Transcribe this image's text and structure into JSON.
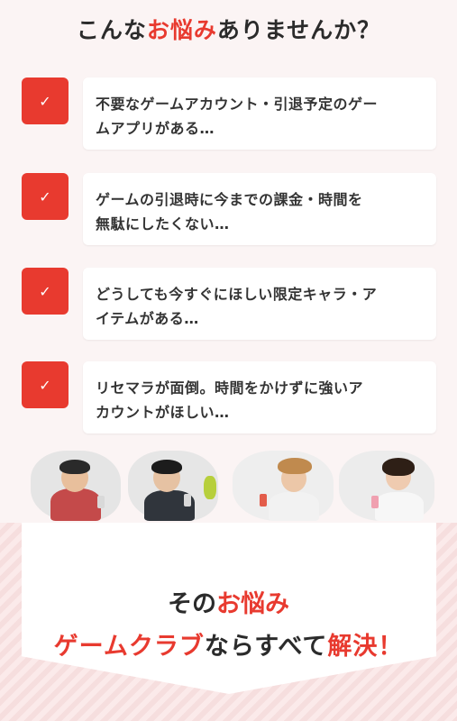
{
  "header": {
    "title_pre": "こんな",
    "title_accent": "お悩み",
    "title_post": "ありませんか？"
  },
  "checklist": [
    {
      "line1": "不要なゲームアカウント・引退予定のゲー",
      "line2": "ムアプリがある…"
    },
    {
      "line1": "ゲームの引退時に今までの課金・時間を",
      "line2": "無駄にしたくない…"
    },
    {
      "line1": "どうしても今すぐにほしい限定キャラ・ア",
      "line2": "イテムがある…"
    },
    {
      "line1": "リセマラが面倒。時間をかけずに強いア",
      "line2": "カウントがほしい…"
    }
  ],
  "icons": {
    "check": "✓"
  },
  "solution": {
    "line1_pre": "その",
    "line1_accent": "お悩み",
    "line2_brand": "ゲームクラブ",
    "line2_mid": "ならすべて",
    "line2_accent": "解決！"
  },
  "colors": {
    "accent": "#e83a2f",
    "text": "#2b2b2b",
    "background": "#fbf4f4"
  }
}
